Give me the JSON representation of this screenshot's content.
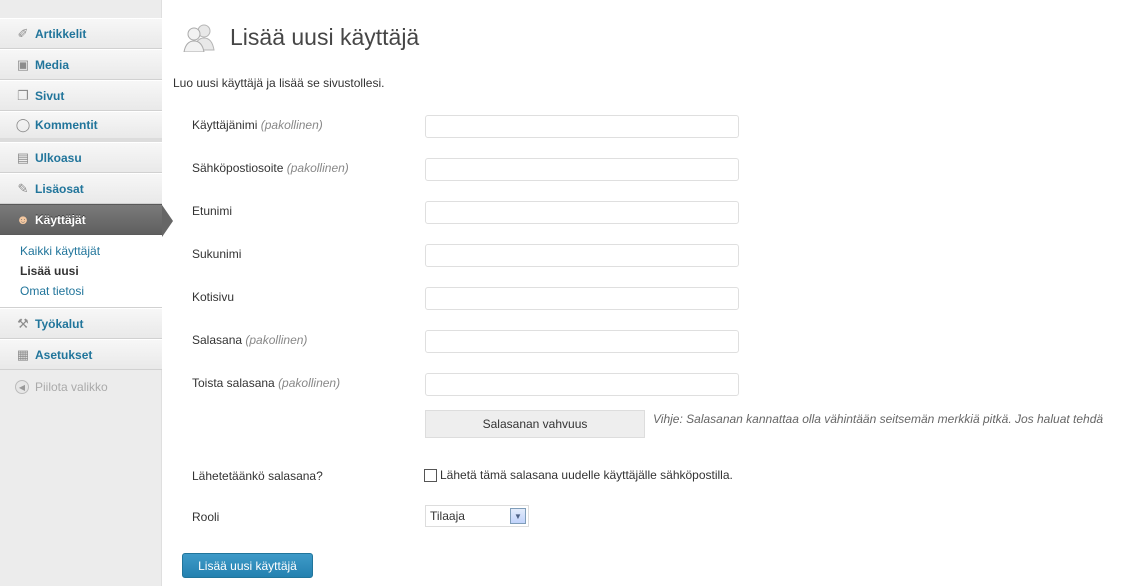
{
  "sidebar": {
    "items": [
      {
        "label": "Artikkelit",
        "icon": "pushpin-icon",
        "glyph": "✐"
      },
      {
        "label": "Media",
        "icon": "media-icon",
        "glyph": "▣"
      },
      {
        "label": "Sivut",
        "icon": "pages-icon",
        "glyph": "❐"
      },
      {
        "label": "Kommentit",
        "icon": "comment-icon",
        "glyph": "◯"
      },
      {
        "label": "Ulkoasu",
        "icon": "appearance-icon",
        "glyph": "▤"
      },
      {
        "label": "Lisäosat",
        "icon": "plugin-icon",
        "glyph": "✎"
      },
      {
        "label": "Käyttäjät",
        "icon": "users-icon",
        "glyph": "☻"
      },
      {
        "label": "Työkalut",
        "icon": "tools-icon",
        "glyph": "⚒"
      },
      {
        "label": "Asetukset",
        "icon": "settings-icon",
        "glyph": "▦"
      }
    ],
    "submenu": [
      "Kaikki käyttäjät",
      "Lisää uusi",
      "Omat tietosi"
    ],
    "collapse_label": "Piilota valikko"
  },
  "page": {
    "title": "Lisää uusi käyttäjä",
    "intro": "Luo uusi käyttäjä ja lisää se sivustollesi."
  },
  "form": {
    "required_note": "(pakollinen)",
    "fields": [
      {
        "label": "Käyttäjänimi",
        "required": true,
        "value": ""
      },
      {
        "label": "Sähköpostiosoite",
        "required": true,
        "value": ""
      },
      {
        "label": "Etunimi",
        "required": false,
        "value": ""
      },
      {
        "label": "Sukunimi",
        "required": false,
        "value": ""
      },
      {
        "label": "Kotisivu",
        "required": false,
        "value": ""
      },
      {
        "label": "Salasana",
        "required": true,
        "value": ""
      },
      {
        "label": "Toista salasana",
        "required": true,
        "value": ""
      }
    ],
    "strength_label": "Salasanan vahvuus",
    "hint": "Vihje: Salasanan kannattaa olla vähintään seitsemän merkkiä pitkä. Jos haluat tehdä",
    "send_label": "Lähetetäänkö salasana?",
    "send_checkbox_label": "Lähetä tämä salasana uudelle käyttäjälle sähköpostilla.",
    "send_checked": false,
    "role_label": "Rooli",
    "role_value": "Tilaaja",
    "submit_label": "Lisää uusi käyttäjä"
  },
  "colors": {
    "link": "#21759b",
    "active_menu": "#6d6d6d",
    "button": "#2481b0"
  }
}
